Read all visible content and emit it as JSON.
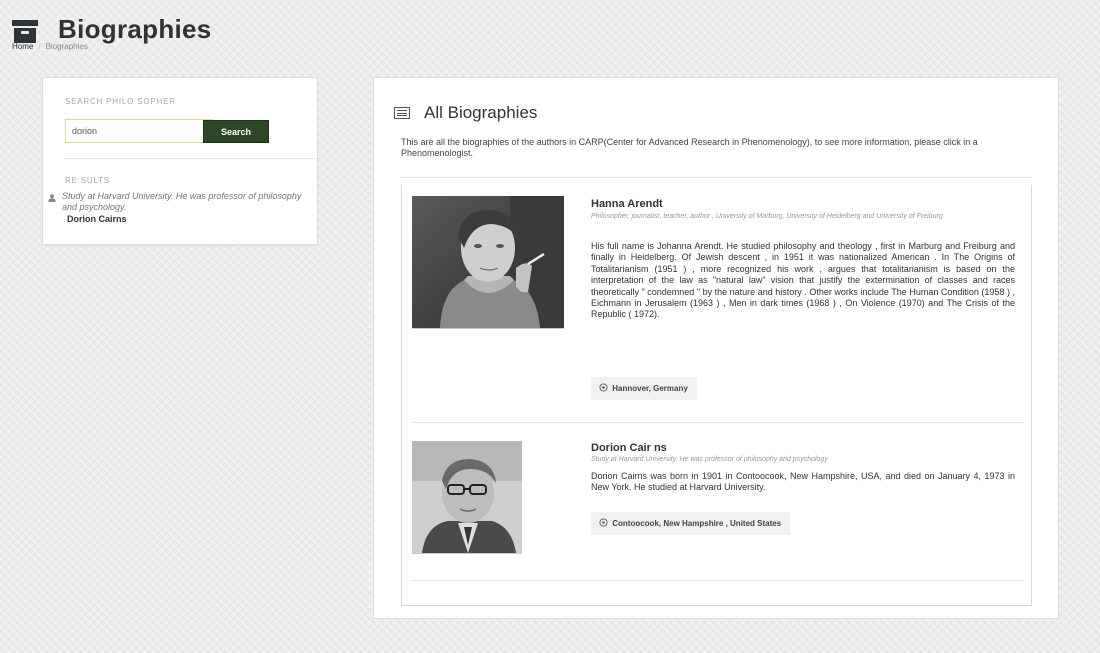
{
  "page": {
    "title": "Biographies",
    "breadcrumb": {
      "home": "Home",
      "separator": "/",
      "current": "Biographies"
    },
    "icons": {
      "header": "archive-box-icon",
      "main": "list-icon",
      "result": "user-icon",
      "location": "map-pin-icon"
    }
  },
  "search": {
    "label": "SEARCH PHILO SOPHER",
    "input_value": "dorion",
    "button_label": "Search",
    "results_label": "RE SULTS",
    "results": [
      {
        "description": "Study at Harvard University. He was professor of philosophy and psychology.",
        "name": "Dorion Cairns"
      }
    ]
  },
  "main": {
    "title": "All Biographies",
    "description": "This are all the biographies of the authors in CARP(Center for Advanced Research in Phenomenology), to see more information, please click in a Phenomenologist.",
    "biographies": [
      {
        "name": "Hanna Arendt",
        "short": "Philosopher, journalist, teacher, author , University of Marburg, University of Heidelberg and University of Freiburg",
        "text": "His full name is Johanna Arendt. He studied philosophy and theology , first in Marburg and Freiburg and finally in Heidelberg. Of Jewish descent , in 1951 it was nationalized American . In The Origins of Totalitarianism (1951 ) , more recognized his work , argues that totalitarianism is based on the interpretation of the law as \"natural law\" vision that justify the extermination of classes and races theoretically \" condemned \" by the nature and history . Other works include The Human Condition (1958 ) , Eichmann in Jerusalem (1963 ) , Men in dark times (1968 ) , On Violence (1970) and The Crisis of the Republic ( 1972).",
        "location": "Hannover, Germany"
      },
      {
        "name": "Dorion Cair ns",
        "short": "Study at Harvard University. He was professor of philosophy and psychology",
        "text": "Dorion Cairns was born in 1901 in Contoocook, New Hampshire, USA, and died on January 4, 1973 in New York. He studied at Harvard University.",
        "location": "Contoocook, New Hampshire , United States"
      }
    ]
  }
}
